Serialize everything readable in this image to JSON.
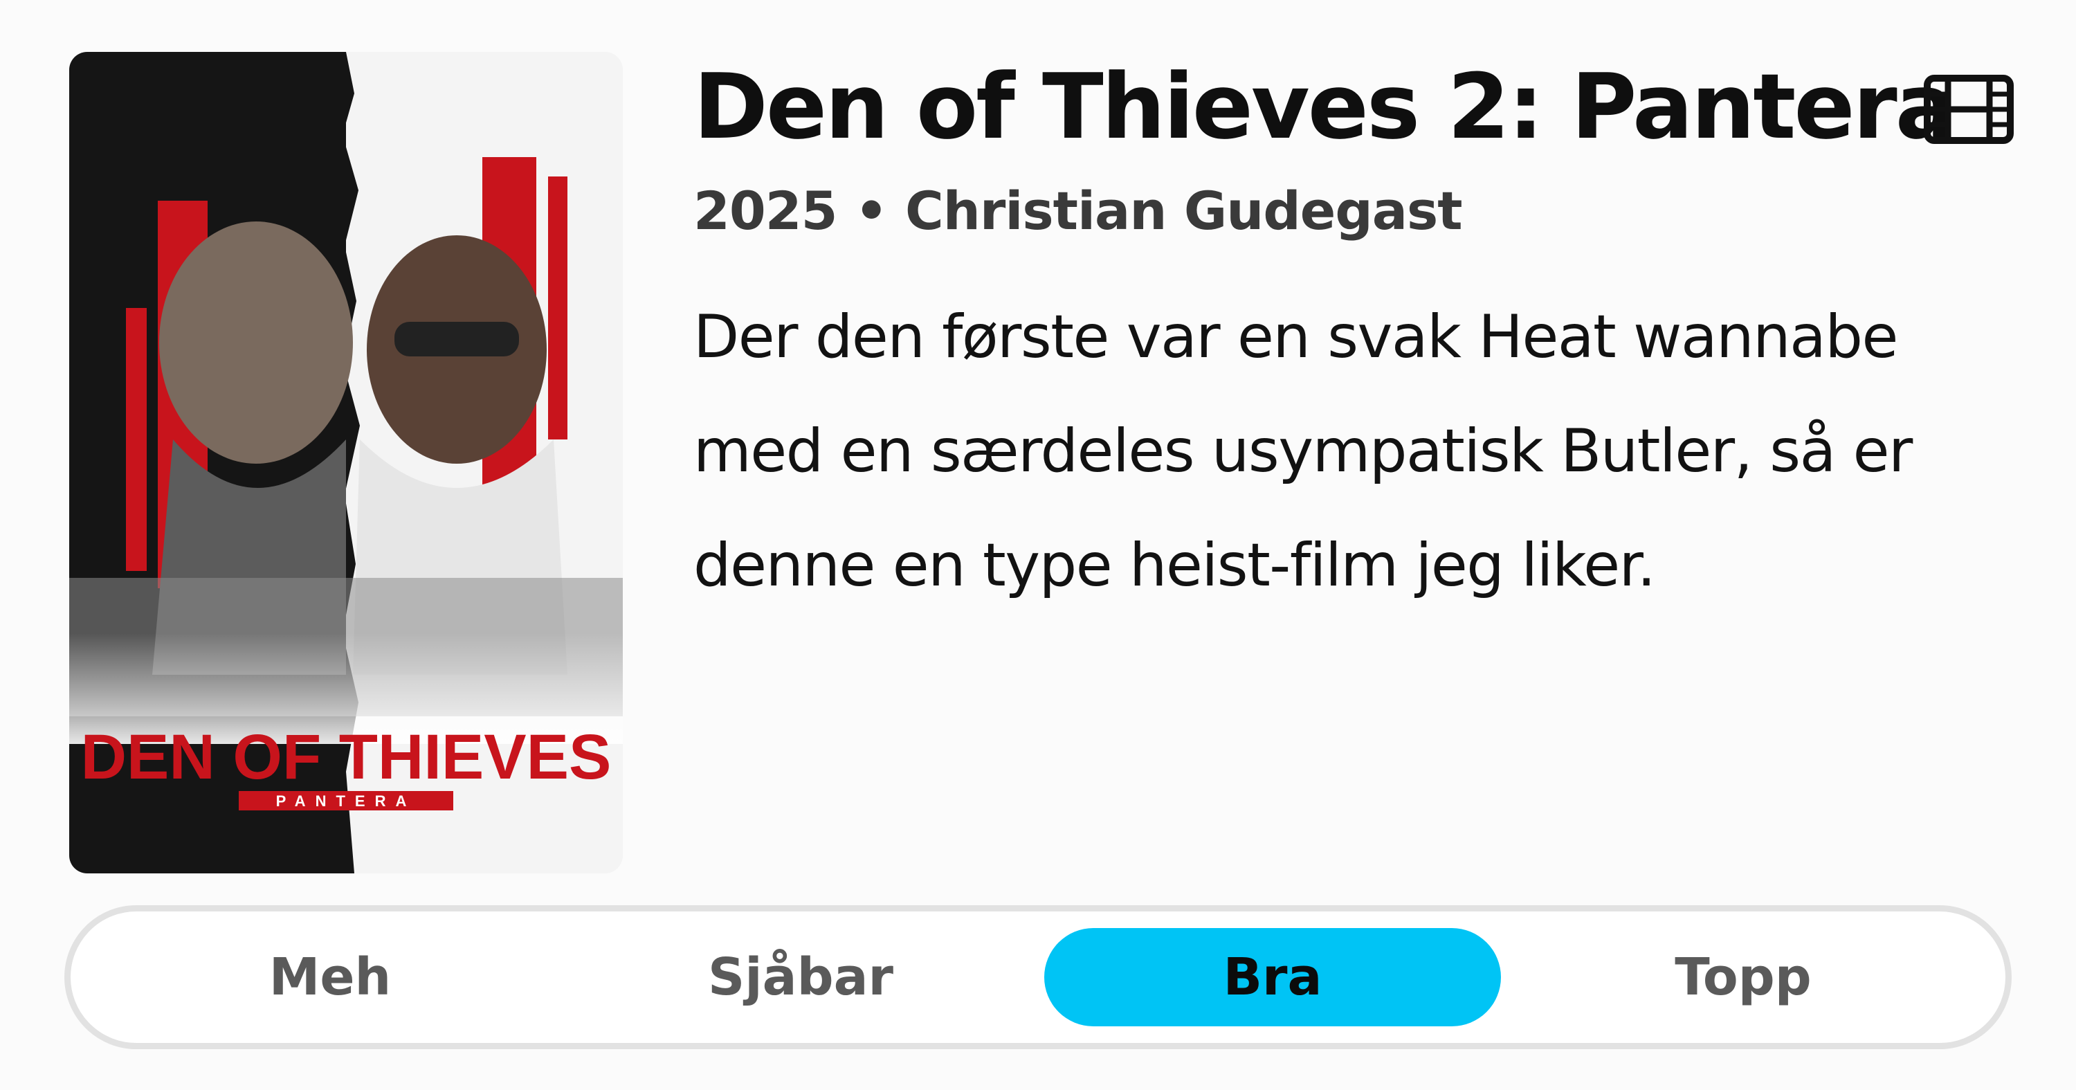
{
  "movie": {
    "title": "Den of Thieves 2: Pantera",
    "subtitle": "2025 • Christian Gudegast",
    "review": "Der den første var en svak Heat wannabe med en særdeles usympatisk Butler, så er denne en type heist-film jeg liker.",
    "type_icon": "film-icon",
    "poster": {
      "title_text": "DEN OF THIEVES",
      "subtitle_text": "PANTERA",
      "accent_color": "#c8141c"
    }
  },
  "rating": {
    "options": [
      {
        "label": "Meh"
      },
      {
        "label": "Sjåbar"
      },
      {
        "label": "Bra"
      },
      {
        "label": "Topp"
      }
    ],
    "selected": "Bra",
    "selected_color": "#00c4f5"
  }
}
